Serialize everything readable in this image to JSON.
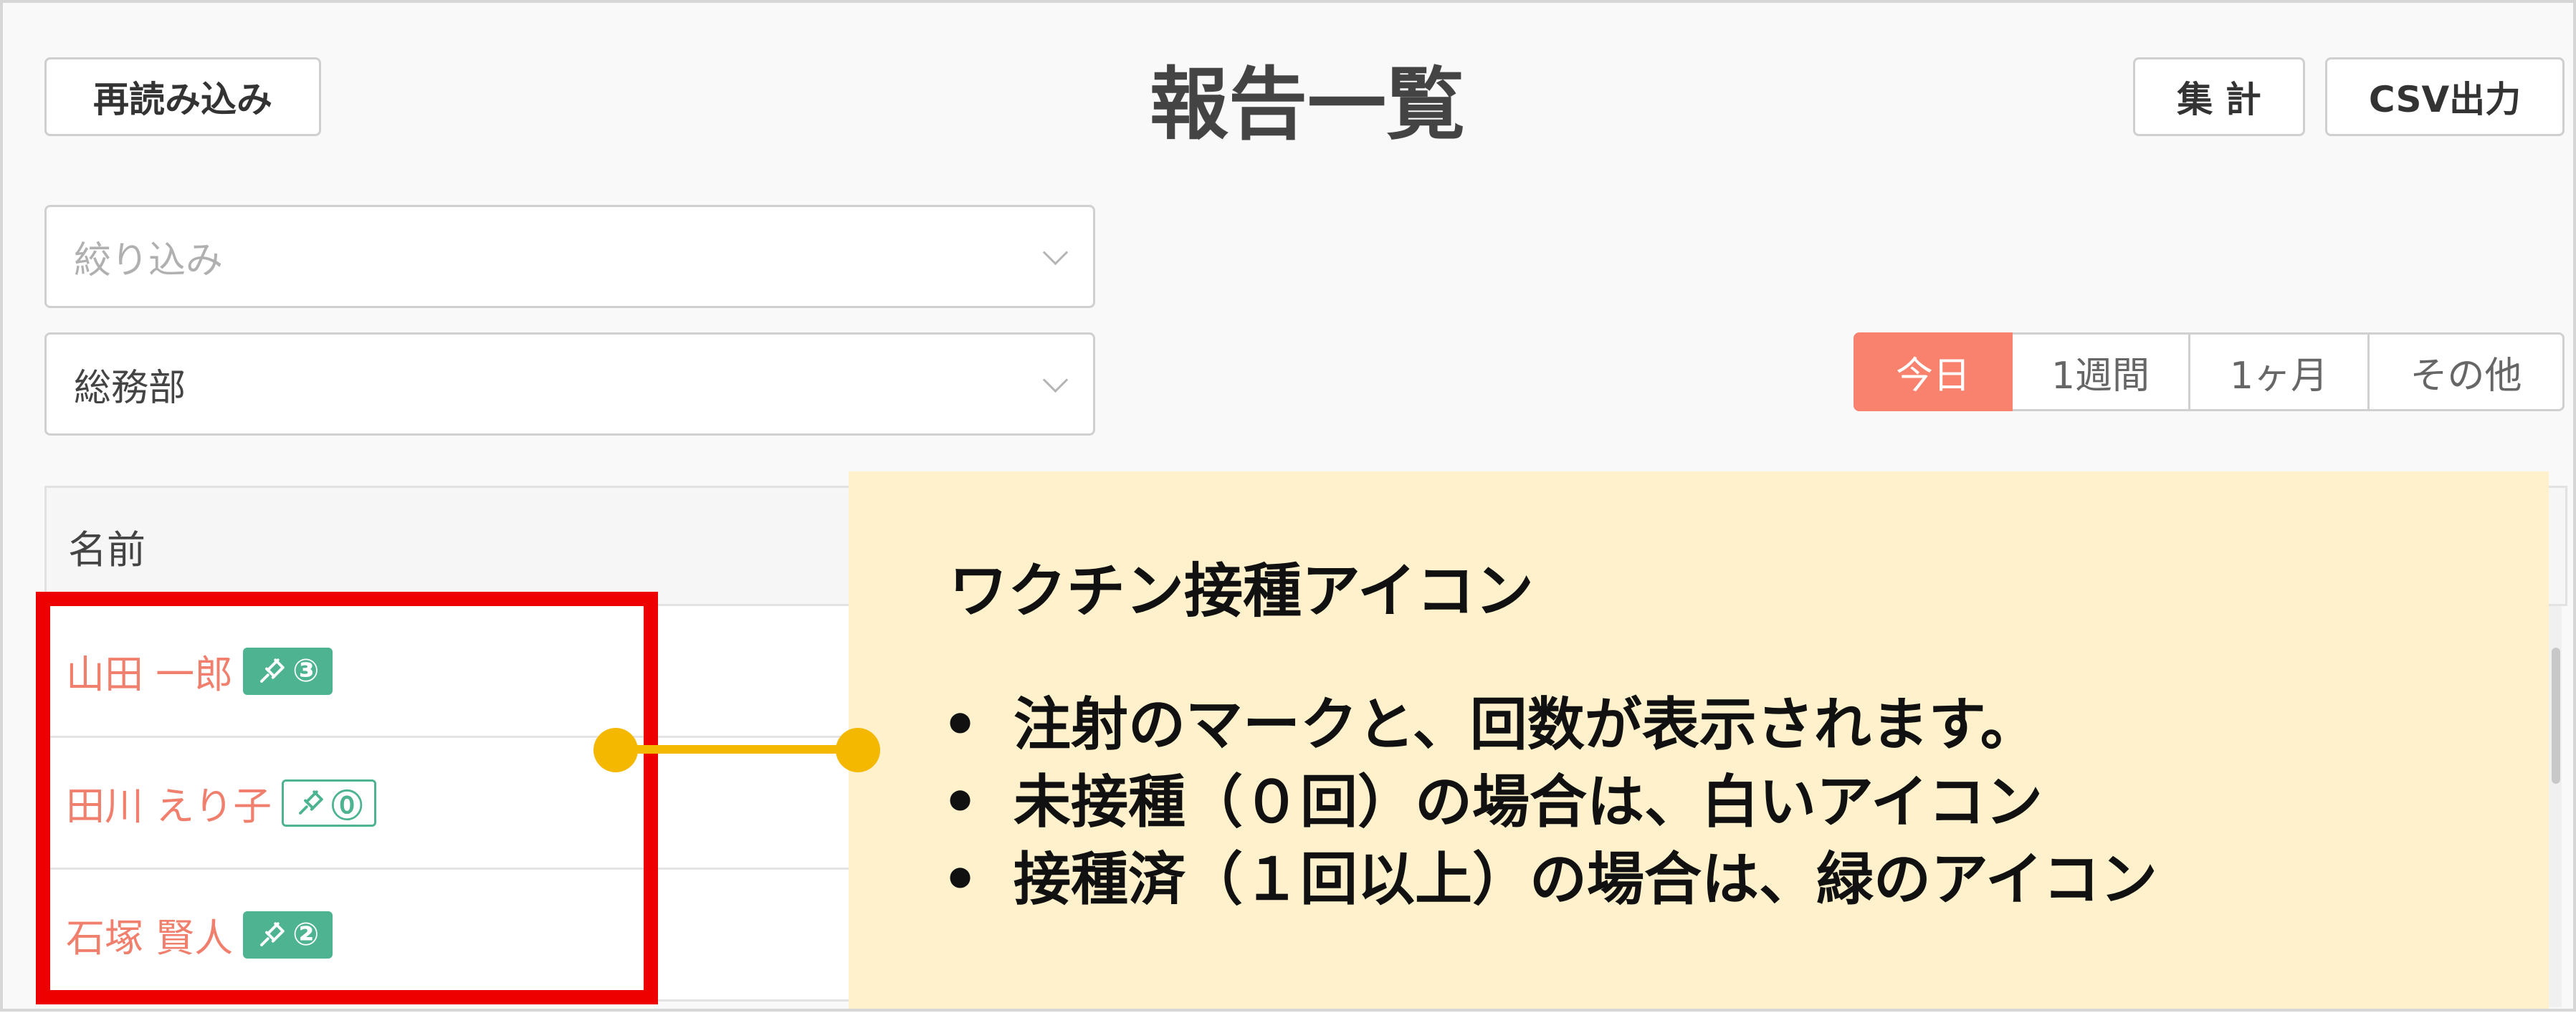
{
  "header": {
    "reload_label": "再読み込み",
    "title": "報告一覧",
    "aggregate_label": "集 計",
    "csv_label": "CSV出力"
  },
  "filters": {
    "refine_placeholder": "絞り込み",
    "department_value": "総務部"
  },
  "period_tabs": [
    {
      "label": "今日",
      "active": true
    },
    {
      "label": "1週間",
      "active": false
    },
    {
      "label": "1ヶ月",
      "active": false
    },
    {
      "label": "その他",
      "active": false
    }
  ],
  "table": {
    "column_name": "名前",
    "rows": [
      {
        "name": "山田 一郎",
        "vaccine_badge": "③",
        "vaccinated": true
      },
      {
        "name": "田川 えり子",
        "vaccine_badge": "⓪",
        "vaccinated": false
      },
      {
        "name": "石塚 賢人",
        "vaccine_badge": "②",
        "vaccinated": true
      }
    ]
  },
  "callout": {
    "title": "ワクチン接種アイコン",
    "bullets": [
      "注射のマークと、回数が表示されます。",
      "未接種（０回）の場合は、白いアイコン",
      "接種済（１回以上）の場合は、緑のアイコン"
    ],
    "bullet_mark": "•"
  },
  "colors": {
    "accent": "#f8826e",
    "badge_green": "#4db391",
    "highlight_red": "#ee0000",
    "callout_bg": "#fef1cc",
    "connector": "#f5b800"
  },
  "icons": {
    "vaccine": "syringe-icon",
    "select": "chevron-down-icon"
  }
}
